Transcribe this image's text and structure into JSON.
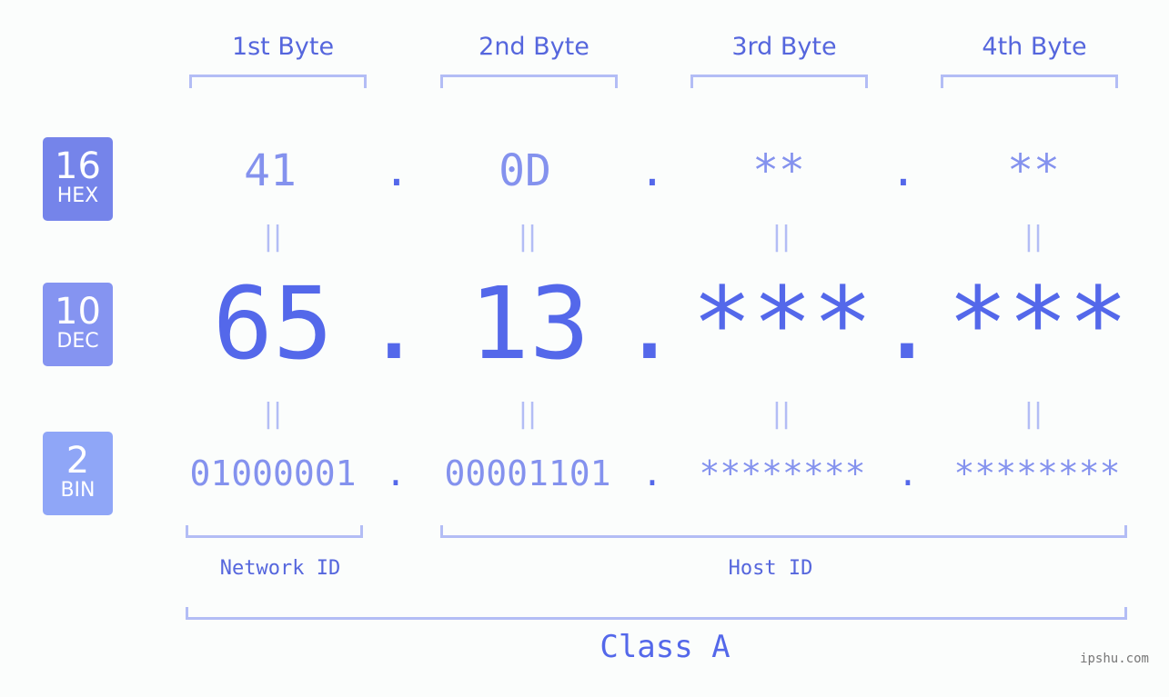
{
  "colors": {
    "hex_badge": "#7584ea",
    "dec_badge": "#8594f1",
    "bin_badge": "#8fa6f7",
    "primary_text": "#5468ea",
    "secondary_text": "#8492ee",
    "bracket": "#b3bdf5",
    "background": "#fbfdfc"
  },
  "badges": [
    {
      "number": "16",
      "label": "HEX"
    },
    {
      "number": "10",
      "label": "DEC"
    },
    {
      "number": "2",
      "label": "BIN"
    }
  ],
  "byte_headers": [
    "1st Byte",
    "2nd Byte",
    "3rd Byte",
    "4th Byte"
  ],
  "separator": ".",
  "equals": "||",
  "hex": [
    "41",
    "0D",
    "**",
    "**"
  ],
  "dec": [
    "65",
    "13",
    "***",
    "***"
  ],
  "bin": [
    "01000001",
    "00001101",
    "********",
    "********"
  ],
  "network_id_label": "Network ID",
  "host_id_label": "Host ID",
  "class_label": "Class A",
  "watermark": "ipshu.com"
}
